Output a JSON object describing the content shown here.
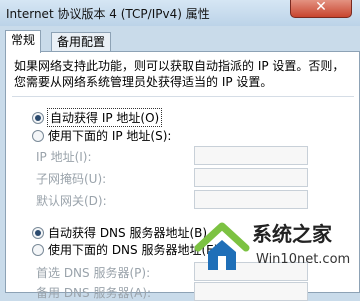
{
  "window": {
    "title": "Internet 协议版本 4 (TCP/IPv4) 属性",
    "close_glyph": "✕"
  },
  "tabs": [
    {
      "label": "常规",
      "active": true
    },
    {
      "label": "备用配置",
      "active": false
    }
  ],
  "description": [
    "如果网络支持此功能，则可以获取自动指派的 IP 设置。否则，",
    "您需要从网络系统管理员处获得适当的 IP 设置。"
  ],
  "ip": {
    "auto_label": "自动获得 IP 地址(O)",
    "auto_selected": true,
    "manual_label": "使用下面的 IP 地址(S):",
    "fields": [
      {
        "label": "IP 地址(I):",
        "value": ""
      },
      {
        "label": "子网掩码(U):",
        "value": ""
      },
      {
        "label": "默认网关(D):",
        "value": ""
      }
    ]
  },
  "dns": {
    "auto_label": "自动获得 DNS 服务器地址(B)",
    "auto_selected": true,
    "manual_label": "使用下面的 DNS 服务器地址(E):",
    "fields": [
      {
        "label": "首选 DNS 服务器(P):",
        "value": ""
      },
      {
        "label": "备用 DNS 服务器(A):",
        "value": ""
      }
    ]
  },
  "watermark": {
    "text_main": "系统之家",
    "text_sub": "Win10net.com",
    "logo_icon": "house-logo-icon"
  }
}
